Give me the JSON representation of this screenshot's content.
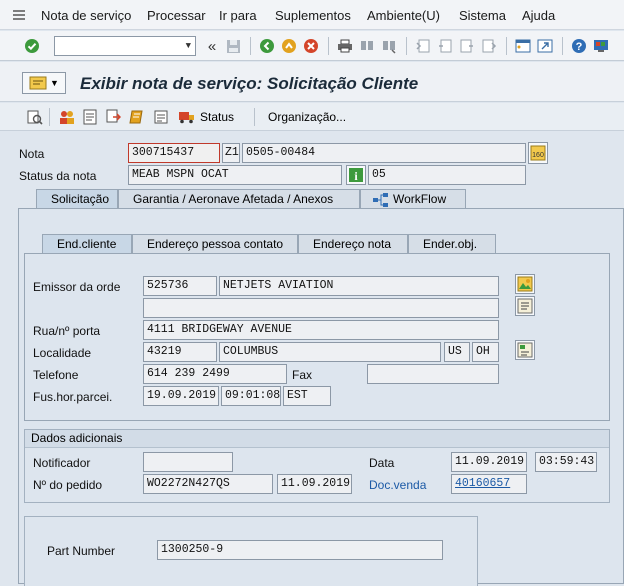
{
  "menubar": {
    "items": [
      "Nota de serviço",
      "Processar",
      "Ir para",
      "Suplementos",
      "Ambiente(U)",
      "Sistema",
      "Ajuda"
    ]
  },
  "toolbar": {
    "command_field_value": "",
    "icons": [
      "enter-icon",
      "back-icon",
      "save-icon",
      "back-green-icon",
      "exit-icon",
      "cancel-icon",
      "print-icon",
      "find-icon",
      "find-next-icon",
      "first-page-icon",
      "prev-page-icon",
      "next-page-icon",
      "last-page-icon",
      "new-session-icon",
      "shortcut-icon",
      "help-icon",
      "customize-icon"
    ]
  },
  "title": "Exibir nota de serviço: Solicitação Cliente",
  "app_toolbar": {
    "status_label": "Status",
    "organizacao_label": "Organização..."
  },
  "header": {
    "nota_label": "Nota",
    "nota_value": "300715437",
    "nota_type": "Z1",
    "nota_desc": "0505-00484",
    "status_label": "Status da nota",
    "status_value": "MEAB MSPN OCAT",
    "status_code": "05"
  },
  "tabs": [
    "Solicitação",
    "Garantia  / Aeronave Afetada / Anexos",
    "WorkFlow"
  ],
  "subtabs": [
    "End.cliente",
    "Endereço pessoa contato",
    "Endereço nota",
    "Ender.obj."
  ],
  "address": {
    "emissor_label": "Emissor da orde",
    "emissor_code": "525736",
    "emissor_name": "NETJETS AVIATION",
    "emissor_name2": "",
    "rua_label": "Rua/nº porta",
    "rua_value": "4111 BRIDGEWAY AVENUE",
    "localidade_label": "Localidade",
    "zip": "43219",
    "city": "COLUMBUS",
    "country": "US",
    "region": "OH",
    "telefone_label": "Telefone",
    "telefone_value": "614 239 2499",
    "fax_label": "Fax",
    "fax_value": "",
    "fus_label": "Fus.hor.parcei.",
    "fus_date": "19.09.2019",
    "fus_time": "09:01:08",
    "fus_tz": "EST"
  },
  "dados": {
    "heading": "Dados adicionais",
    "notificador_label": "Notificador",
    "notificador_value": "",
    "data_label": "Data",
    "data_value": "11.09.2019",
    "data_time": "03:59:43",
    "pedido_label": "Nº do pedido",
    "pedido_value": "WO2272N427QS",
    "pedido_date": "11.09.2019",
    "docvenda_label": "Doc.venda",
    "docvenda_value": "40160657"
  },
  "part": {
    "label": "Part Number",
    "value": "1300250-9"
  }
}
